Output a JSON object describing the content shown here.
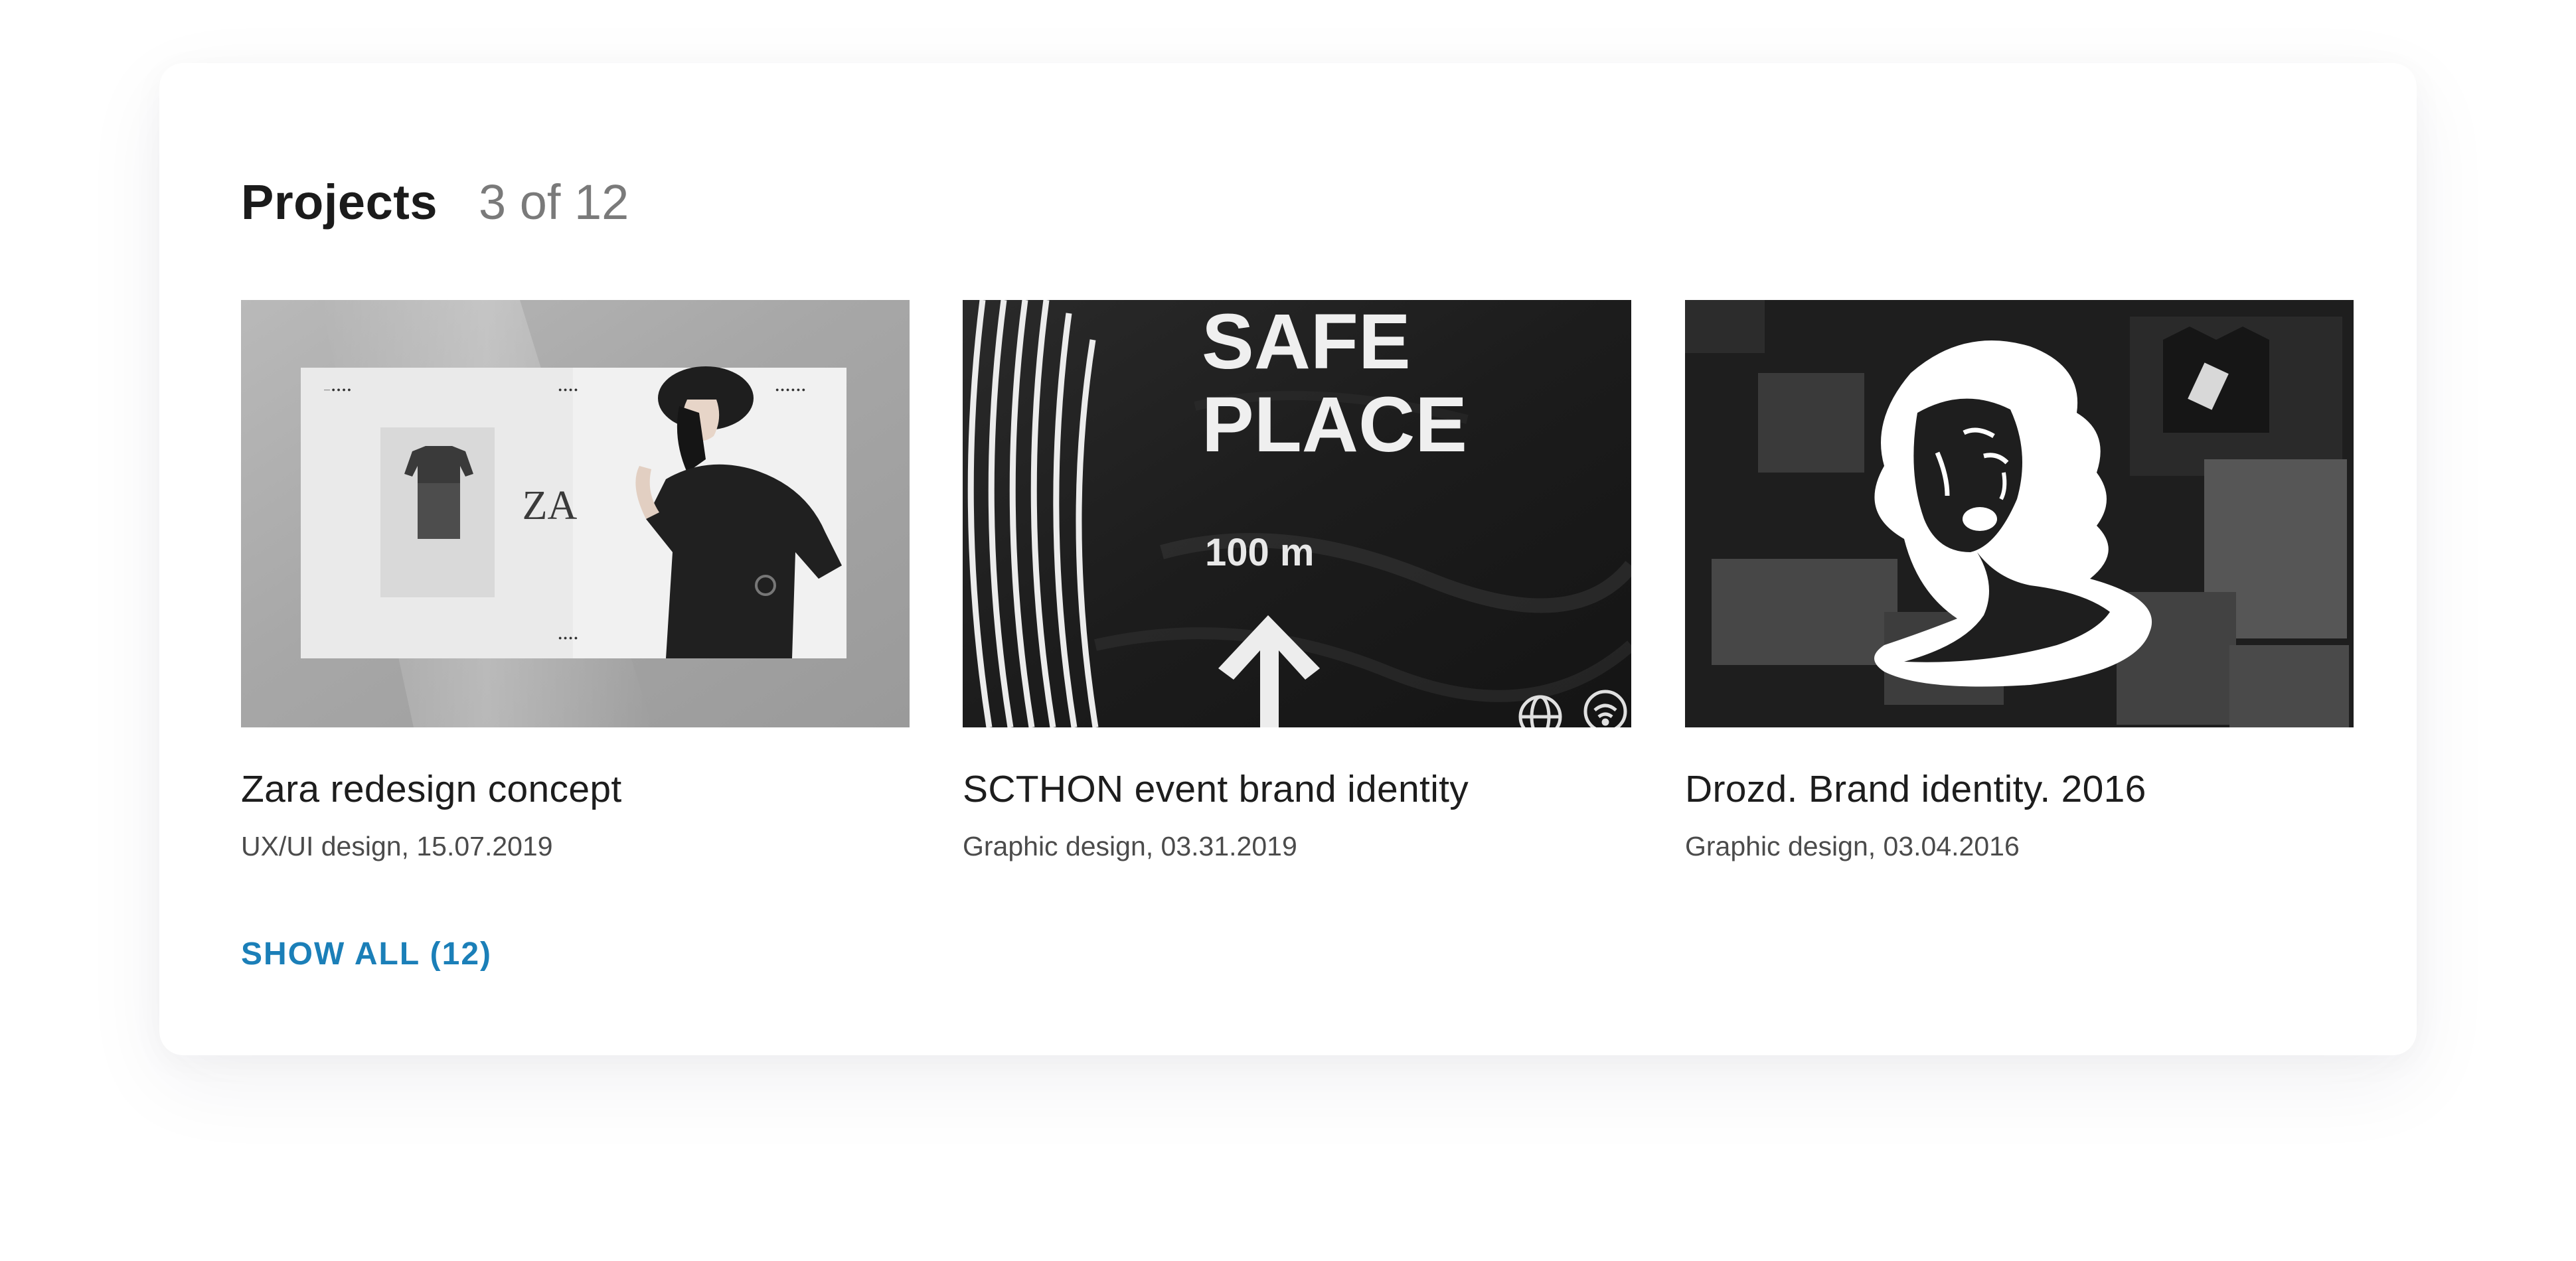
{
  "header": {
    "title": "Projects",
    "count": "3 of 12"
  },
  "projects": [
    {
      "title": "Zara redesign concept",
      "meta": "UX/UI design, 15.07.2019",
      "image": {
        "logo_text": "ZA",
        "nav_left": "— ● ● ● ●",
        "nav_center": "● ● ● ●",
        "nav_right": "● ● ● ● ● ●",
        "footer_dots": "● ● ● ●"
      }
    },
    {
      "title": "SCTHON event brand identity",
      "meta": "Graphic design, 03.31.2019",
      "image": {
        "headline_line1": "SAFE",
        "headline_line2": "PLACE",
        "distance": "100 m"
      }
    },
    {
      "title": "Drozd. Brand identity. 2016",
      "meta": "Graphic design, 03.04.2016",
      "image": {}
    }
  ],
  "show_all_label": "SHOW ALL (12)",
  "colors": {
    "accent": "#1b7fb8",
    "title_text": "#1b1b1b",
    "count_text": "#7a7a7a"
  }
}
